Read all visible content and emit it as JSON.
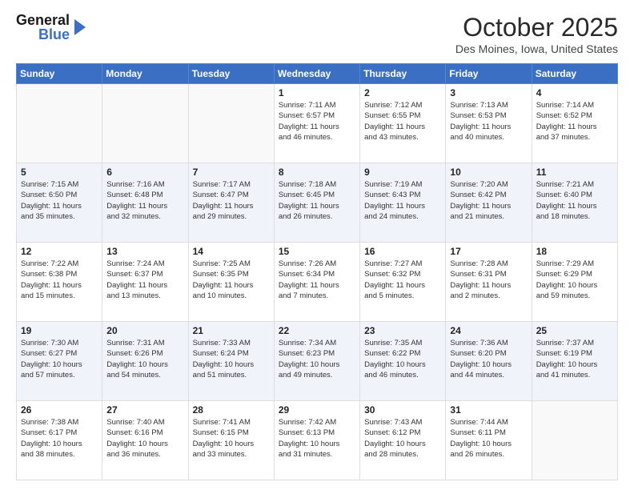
{
  "header": {
    "logo_general": "General",
    "logo_blue": "Blue",
    "month_title": "October 2025",
    "location": "Des Moines, Iowa, United States"
  },
  "weekdays": [
    "Sunday",
    "Monday",
    "Tuesday",
    "Wednesday",
    "Thursday",
    "Friday",
    "Saturday"
  ],
  "weeks": [
    [
      {
        "day": "",
        "info": ""
      },
      {
        "day": "",
        "info": ""
      },
      {
        "day": "",
        "info": ""
      },
      {
        "day": "1",
        "info": "Sunrise: 7:11 AM\nSunset: 6:57 PM\nDaylight: 11 hours\nand 46 minutes."
      },
      {
        "day": "2",
        "info": "Sunrise: 7:12 AM\nSunset: 6:55 PM\nDaylight: 11 hours\nand 43 minutes."
      },
      {
        "day": "3",
        "info": "Sunrise: 7:13 AM\nSunset: 6:53 PM\nDaylight: 11 hours\nand 40 minutes."
      },
      {
        "day": "4",
        "info": "Sunrise: 7:14 AM\nSunset: 6:52 PM\nDaylight: 11 hours\nand 37 minutes."
      }
    ],
    [
      {
        "day": "5",
        "info": "Sunrise: 7:15 AM\nSunset: 6:50 PM\nDaylight: 11 hours\nand 35 minutes."
      },
      {
        "day": "6",
        "info": "Sunrise: 7:16 AM\nSunset: 6:48 PM\nDaylight: 11 hours\nand 32 minutes."
      },
      {
        "day": "7",
        "info": "Sunrise: 7:17 AM\nSunset: 6:47 PM\nDaylight: 11 hours\nand 29 minutes."
      },
      {
        "day": "8",
        "info": "Sunrise: 7:18 AM\nSunset: 6:45 PM\nDaylight: 11 hours\nand 26 minutes."
      },
      {
        "day": "9",
        "info": "Sunrise: 7:19 AM\nSunset: 6:43 PM\nDaylight: 11 hours\nand 24 minutes."
      },
      {
        "day": "10",
        "info": "Sunrise: 7:20 AM\nSunset: 6:42 PM\nDaylight: 11 hours\nand 21 minutes."
      },
      {
        "day": "11",
        "info": "Sunrise: 7:21 AM\nSunset: 6:40 PM\nDaylight: 11 hours\nand 18 minutes."
      }
    ],
    [
      {
        "day": "12",
        "info": "Sunrise: 7:22 AM\nSunset: 6:38 PM\nDaylight: 11 hours\nand 15 minutes."
      },
      {
        "day": "13",
        "info": "Sunrise: 7:24 AM\nSunset: 6:37 PM\nDaylight: 11 hours\nand 13 minutes."
      },
      {
        "day": "14",
        "info": "Sunrise: 7:25 AM\nSunset: 6:35 PM\nDaylight: 11 hours\nand 10 minutes."
      },
      {
        "day": "15",
        "info": "Sunrise: 7:26 AM\nSunset: 6:34 PM\nDaylight: 11 hours\nand 7 minutes."
      },
      {
        "day": "16",
        "info": "Sunrise: 7:27 AM\nSunset: 6:32 PM\nDaylight: 11 hours\nand 5 minutes."
      },
      {
        "day": "17",
        "info": "Sunrise: 7:28 AM\nSunset: 6:31 PM\nDaylight: 11 hours\nand 2 minutes."
      },
      {
        "day": "18",
        "info": "Sunrise: 7:29 AM\nSunset: 6:29 PM\nDaylight: 10 hours\nand 59 minutes."
      }
    ],
    [
      {
        "day": "19",
        "info": "Sunrise: 7:30 AM\nSunset: 6:27 PM\nDaylight: 10 hours\nand 57 minutes."
      },
      {
        "day": "20",
        "info": "Sunrise: 7:31 AM\nSunset: 6:26 PM\nDaylight: 10 hours\nand 54 minutes."
      },
      {
        "day": "21",
        "info": "Sunrise: 7:33 AM\nSunset: 6:24 PM\nDaylight: 10 hours\nand 51 minutes."
      },
      {
        "day": "22",
        "info": "Sunrise: 7:34 AM\nSunset: 6:23 PM\nDaylight: 10 hours\nand 49 minutes."
      },
      {
        "day": "23",
        "info": "Sunrise: 7:35 AM\nSunset: 6:22 PM\nDaylight: 10 hours\nand 46 minutes."
      },
      {
        "day": "24",
        "info": "Sunrise: 7:36 AM\nSunset: 6:20 PM\nDaylight: 10 hours\nand 44 minutes."
      },
      {
        "day": "25",
        "info": "Sunrise: 7:37 AM\nSunset: 6:19 PM\nDaylight: 10 hours\nand 41 minutes."
      }
    ],
    [
      {
        "day": "26",
        "info": "Sunrise: 7:38 AM\nSunset: 6:17 PM\nDaylight: 10 hours\nand 38 minutes."
      },
      {
        "day": "27",
        "info": "Sunrise: 7:40 AM\nSunset: 6:16 PM\nDaylight: 10 hours\nand 36 minutes."
      },
      {
        "day": "28",
        "info": "Sunrise: 7:41 AM\nSunset: 6:15 PM\nDaylight: 10 hours\nand 33 minutes."
      },
      {
        "day": "29",
        "info": "Sunrise: 7:42 AM\nSunset: 6:13 PM\nDaylight: 10 hours\nand 31 minutes."
      },
      {
        "day": "30",
        "info": "Sunrise: 7:43 AM\nSunset: 6:12 PM\nDaylight: 10 hours\nand 28 minutes."
      },
      {
        "day": "31",
        "info": "Sunrise: 7:44 AM\nSunset: 6:11 PM\nDaylight: 10 hours\nand 26 minutes."
      },
      {
        "day": "",
        "info": ""
      }
    ]
  ]
}
